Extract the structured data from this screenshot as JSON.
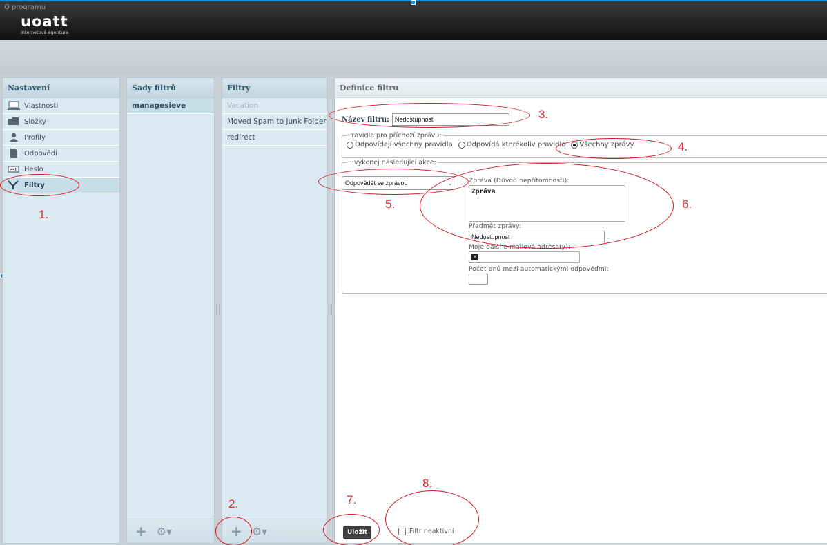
{
  "topbar": {
    "about_link": "O programu",
    "logo_main": "uoatt",
    "logo_sub": "internetová agentura"
  },
  "settings": {
    "title": "Nastavení",
    "items": [
      {
        "label": "Vlastnosti",
        "icon": "monitor-icon"
      },
      {
        "label": "Složky",
        "icon": "folder-icon"
      },
      {
        "label": "Profily",
        "icon": "user-icon"
      },
      {
        "label": "Odpovědi",
        "icon": "document-icon"
      },
      {
        "label": "Heslo",
        "icon": "password-icon"
      },
      {
        "label": "Filtry",
        "icon": "filter-icon"
      }
    ]
  },
  "filter_sets": {
    "title": "Sady filtrů",
    "items": [
      "managesieve"
    ]
  },
  "filters": {
    "title": "Filtry",
    "items": [
      "Vacation",
      "Moved Spam to Junk Folder",
      "redirect"
    ]
  },
  "definition": {
    "title": "Definice filtru",
    "name_label": "Název filtru:",
    "name_value": "Nedostupnost",
    "rules_legend": "Pravidla pro příchozí zprávu:",
    "rule_options": [
      "Odpovídají všechny pravidla",
      "Odpovídá kterékoliv pravidlo",
      "Všechny zprávy"
    ],
    "selected_rule": "Všechny zprávy",
    "actions_legend": "...vykonej následující akce:",
    "action_select": "Odpovědět se zprávou",
    "message_label": "Zpráva (Důvod nepřítomnosti):",
    "message_value": "Zpráva",
    "subject_label": "Předmět zprávy:",
    "subject_value": "Nedostupnost",
    "addresses_label": "Moje další e-mailová adresa(y):",
    "days_label": "Počet dnů mezi automatickými odpověďmi:",
    "days_value": "",
    "save_label": "Uložit",
    "inactive_label": "Filtr neaktivní"
  },
  "annotations": [
    "1.",
    "2.",
    "3.",
    "4.",
    "5.",
    "6.",
    "7.",
    "8."
  ],
  "colors": {
    "annotation_red": "#d6141f",
    "panel_blue": "#d9eaf2",
    "topbar_dark": "#1a1a1a"
  }
}
